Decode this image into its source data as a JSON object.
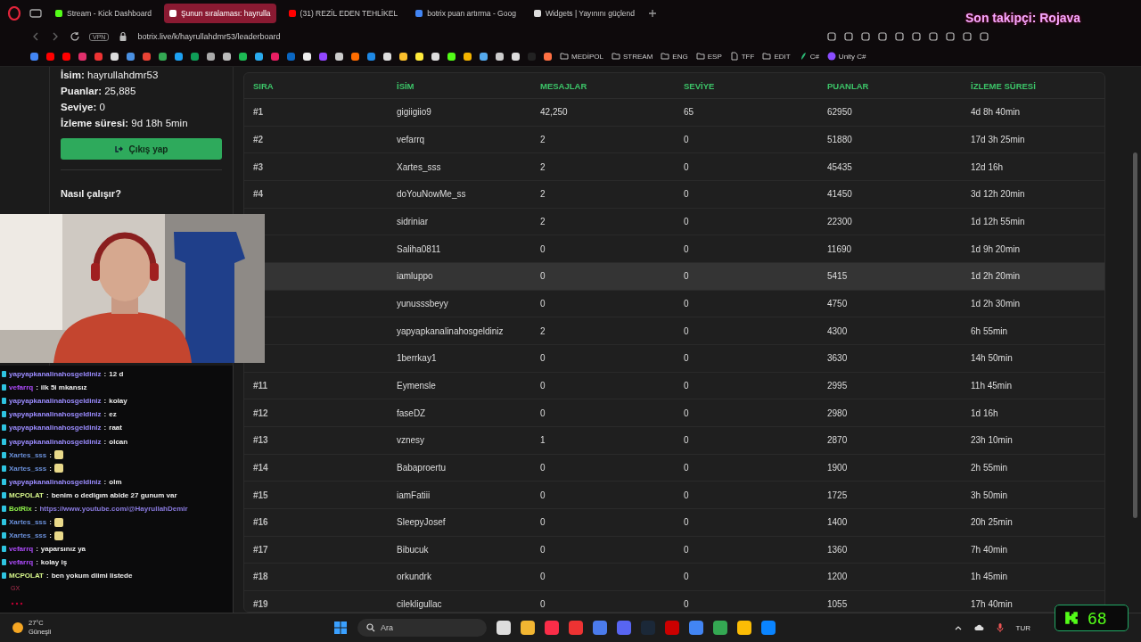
{
  "browser": {
    "tabs": [
      {
        "label": "Stream - Kick Dashboard",
        "selected": false,
        "color": "#53fc18"
      },
      {
        "label": "Şunun sıralaması: hayrulla",
        "selected": true,
        "color": "#ffffff"
      },
      {
        "label": "(31) REZİL EDEN TEHLİKEL",
        "selected": false,
        "color": "#ff0000"
      },
      {
        "label": "botrix puan artırma - Goog",
        "selected": false,
        "color": "#4285f4"
      },
      {
        "label": "Widgets | Yayınını güçlend",
        "selected": false,
        "color": "#dddddd"
      }
    ],
    "vpn": "VPN",
    "url": "botrix.live/k/hayrullahdmr53/leaderboard",
    "bookmark_folders": [
      {
        "label": "MEDİPOL",
        "kind": "folder"
      },
      {
        "label": "STREAM",
        "kind": "folder"
      },
      {
        "label": "ENG",
        "kind": "folder"
      },
      {
        "label": "ESP",
        "kind": "folder"
      },
      {
        "label": "TFF",
        "kind": "page"
      },
      {
        "label": "EDIT",
        "kind": "folder"
      },
      {
        "label": "C#",
        "kind": "leaf"
      },
      {
        "label": "Unity C#",
        "kind": "unity"
      }
    ]
  },
  "profile": {
    "lines": [
      "**İsim:** hayrullahdmr53",
      "**Puanlar:** 25,885",
      "**Seviye:** 0",
      "**İzleme süresi:** 9d 18h 5min"
    ],
    "logout": "Çıkış yap",
    "how_it_works": "Nasıl çalışır?"
  },
  "leaderboard": {
    "columns": [
      "SIRA",
      "İSİM",
      "MESAJLAR",
      "SEVİYE",
      "PUANLAR",
      "İZLEME SÜRESİ"
    ],
    "rows": [
      {
        "rank": "#1",
        "name": "gigiigiio9",
        "messages": "42,250",
        "level": "65",
        "points": "62950",
        "watch": "4d 8h 40min",
        "selected": false
      },
      {
        "rank": "#2",
        "name": "vefarrq",
        "messages": "2",
        "level": "0",
        "points": "51880",
        "watch": "17d 3h 25min",
        "selected": false
      },
      {
        "rank": "#3",
        "name": "Xartes_sss",
        "messages": "2",
        "level": "0",
        "points": "45435",
        "watch": "12d 16h",
        "selected": false
      },
      {
        "rank": "#4",
        "name": "doYouNowMe_ss",
        "messages": "2",
        "level": "0",
        "points": "41450",
        "watch": "3d 12h 20min",
        "selected": false
      },
      {
        "name": "sidriniar",
        "messages": "2",
        "level": "0",
        "points": "22300",
        "watch": "1d 12h 55min",
        "selected": false
      },
      {
        "name": "Saliha0811",
        "messages": "0",
        "level": "0",
        "points": "11690",
        "watch": "1d 9h 20min",
        "selected": false
      },
      {
        "name": "iamluppo",
        "messages": "0",
        "level": "0",
        "points": "5415",
        "watch": "1d 2h 20min",
        "selected": true
      },
      {
        "name": "yunusssbeyy",
        "messages": "0",
        "level": "0",
        "points": "4750",
        "watch": "1d 2h 30min",
        "selected": false
      },
      {
        "name": "yapyapkanalinahosgeldiniz",
        "messages": "2",
        "level": "0",
        "points": "4300",
        "watch": "6h 55min",
        "selected": false
      },
      {
        "name": "1berrkay1",
        "messages": "0",
        "level": "0",
        "points": "3630",
        "watch": "14h 50min",
        "selected": false
      },
      {
        "rank": "#11",
        "name": "Eymensle",
        "messages": "0",
        "level": "0",
        "points": "2995",
        "watch": "11h 45min",
        "selected": false
      },
      {
        "rank": "#12",
        "name": "faseDZ",
        "messages": "0",
        "level": "0",
        "points": "2980",
        "watch": "1d 16h",
        "selected": false
      },
      {
        "rank": "#13",
        "name": "vznesy",
        "messages": "1",
        "level": "0",
        "points": "2870",
        "watch": "23h 10min",
        "selected": false
      },
      {
        "rank": "#14",
        "name": "Babaproertu",
        "messages": "0",
        "level": "0",
        "points": "1900",
        "watch": "2h 55min",
        "selected": false
      },
      {
        "rank": "#15",
        "name": "iamFatiii",
        "messages": "0",
        "level": "0",
        "points": "1725",
        "watch": "3h 50min",
        "selected": false
      },
      {
        "rank": "#16",
        "name": "SleepyJosef",
        "messages": "0",
        "level": "0",
        "points": "1400",
        "watch": "20h 25min",
        "selected": false
      },
      {
        "rank": "#17",
        "name": "Bibucuk",
        "messages": "0",
        "level": "0",
        "points": "1360",
        "watch": "7h 40min",
        "selected": false
      },
      {
        "rank": "#18",
        "name": "orkundrk",
        "messages": "0",
        "level": "0",
        "points": "1200",
        "watch": "1h 45min",
        "selected": false
      },
      {
        "rank": "#19",
        "name": "cilekligullac",
        "messages": "0",
        "level": "0",
        "points": "1055",
        "watch": "17h 40min",
        "selected": false
      }
    ]
  },
  "overlay": {
    "follower": "Son takipçi: Rojava",
    "kick_count": "68",
    "chat": [
      {
        "user": "yapyapkanalinahosgeldiniz",
        "color": "#9b8cff",
        "kind": "text",
        "text": "12 d"
      },
      {
        "user": "vefarrq",
        "color": "#b04cff",
        "kind": "text",
        "text": "ilk 5i mkansız"
      },
      {
        "user": "yapyapkanalinahosgeldiniz",
        "color": "#9b8cff",
        "kind": "text",
        "text": "kolay"
      },
      {
        "user": "yapyapkanalinahosgeldiniz",
        "color": "#9b8cff",
        "kind": "text",
        "text": "ez"
      },
      {
        "user": "yapyapkanalinahosgeldiniz",
        "color": "#9b8cff",
        "kind": "text",
        "text": "raat"
      },
      {
        "user": "yapyapkanalinahosgeldiniz",
        "color": "#9b8cff",
        "kind": "text",
        "text": "olcan"
      },
      {
        "user": "Xartes_sss",
        "color": "#6a8fd8",
        "kind": "emote"
      },
      {
        "user": "Xartes_sss",
        "color": "#6a8fd8",
        "kind": "emote"
      },
      {
        "user": "yapyapkanalinahosgeldiniz",
        "color": "#9b8cff",
        "kind": "text",
        "text": "olm"
      },
      {
        "user": "MCPOLAT",
        "color": "#d6f58a",
        "kind": "text",
        "text": "benim o dedigım abide 27 gunum var"
      },
      {
        "user": "BotRix",
        "color": "#8ef04a",
        "kind": "link",
        "text": "https://www.youtube.com/@HayrullahDemir"
      },
      {
        "user": "Xartes_sss",
        "color": "#6a8fd8",
        "kind": "emote"
      },
      {
        "user": "Xartes_sss",
        "color": "#6a8fd8",
        "kind": "emote"
      },
      {
        "user": "vefarrq",
        "color": "#b04cff",
        "kind": "text",
        "text": "yaparsınız ya"
      },
      {
        "user": "vefarrq",
        "color": "#b04cff",
        "kind": "text",
        "text": "kolay iş"
      },
      {
        "user": "MCPOLAT",
        "color": "#d6f58a",
        "kind": "text",
        "text": "ben yokum diimi listede"
      }
    ],
    "chat_separator": ":",
    "chat_footer": "GX"
  },
  "taskbar": {
    "temperature": "27°C",
    "weather": "Güneşli",
    "search_placeholder": "Ara",
    "language": "TUR"
  }
}
